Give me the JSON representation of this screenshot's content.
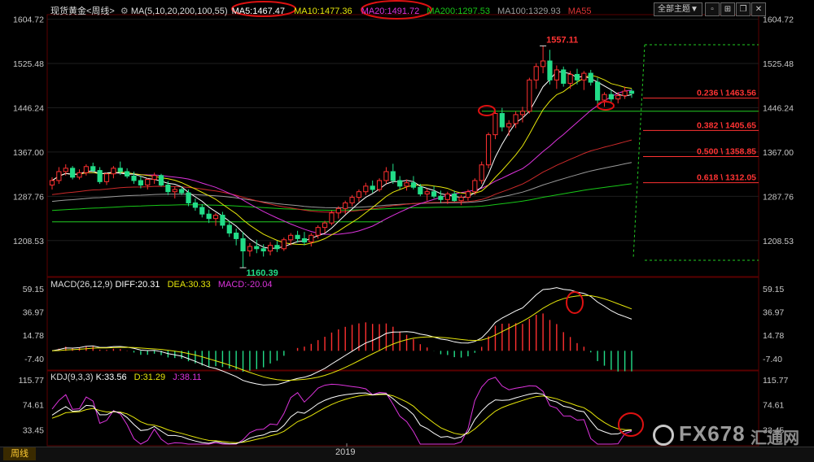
{
  "header": {
    "symbol": "现货黄金",
    "period_label": "<周线>",
    "ma_params": "MA(5,10,20,200,100,55)",
    "ma5": "MA5:1467.47",
    "ma10": "MA10:1477.36",
    "ma20": "MA20:1491.72",
    "ma200": "MA200:1297.53",
    "ma100": "MA100:1329.93",
    "ma55": "MA55",
    "theme_button": "全部主题▼",
    "icons": [
      "box-icon",
      "grid-icon",
      "restore-icon",
      "close-icon"
    ]
  },
  "footer": {
    "period_tab": "周线",
    "year_label": "2019"
  },
  "watermark": {
    "text": "FX678",
    "subtext": "汇通网"
  },
  "colors": {
    "up": "#ff3030",
    "down": "#22dd88",
    "ma5": "#ffffff",
    "ma10": "#e6e60a",
    "ma20": "#dd33dd",
    "ma200": "#18c818",
    "ma100": "#9a9a9a",
    "ma55": "#cc2a2a",
    "fib": "#ff3333",
    "annotation": "#dd1111"
  },
  "chart_data": [
    {
      "type": "candlestick",
      "title": "现货黄金<周线>",
      "y_ticks": [
        "1604.72",
        "1525.48",
        "1446.24",
        "1367.00",
        "1287.76",
        "1208.53"
      ],
      "ylim": [
        1150,
        1610
      ],
      "annotations": {
        "high": "1557.11",
        "low": "1160.39"
      },
      "fibonacci": [
        {
          "label": "0.236 \\ 1463.56",
          "value": 1463.56
        },
        {
          "label": "0.382 \\ 1405.65",
          "value": 1405.65
        },
        {
          "label": "0.500 \\ 1358.85",
          "value": 1358.85
        },
        {
          "label": "0.618 \\ 1312.05",
          "value": 1312.05
        }
      ],
      "support_level": 1440,
      "ohlc": [
        [
          1308,
          1322,
          1300,
          1316
        ],
        [
          1316,
          1340,
          1310,
          1332
        ],
        [
          1332,
          1345,
          1325,
          1338
        ],
        [
          1338,
          1342,
          1318,
          1322
        ],
        [
          1322,
          1336,
          1318,
          1330
        ],
        [
          1330,
          1345,
          1325,
          1341
        ],
        [
          1341,
          1348,
          1330,
          1334
        ],
        [
          1334,
          1340,
          1310,
          1314
        ],
        [
          1314,
          1330,
          1308,
          1328
        ],
        [
          1328,
          1342,
          1320,
          1338
        ],
        [
          1338,
          1350,
          1326,
          1332
        ],
        [
          1332,
          1338,
          1320,
          1324
        ],
        [
          1324,
          1332,
          1310,
          1316
        ],
        [
          1316,
          1324,
          1302,
          1308
        ],
        [
          1308,
          1320,
          1300,
          1318
        ],
        [
          1318,
          1330,
          1310,
          1325
        ],
        [
          1325,
          1328,
          1305,
          1308
        ],
        [
          1308,
          1315,
          1290,
          1296
        ],
        [
          1296,
          1305,
          1284,
          1300
        ],
        [
          1300,
          1306,
          1290,
          1294
        ],
        [
          1294,
          1300,
          1270,
          1276
        ],
        [
          1276,
          1284,
          1262,
          1268
        ],
        [
          1268,
          1274,
          1250,
          1256
        ],
        [
          1256,
          1264,
          1240,
          1248
        ],
        [
          1248,
          1258,
          1235,
          1254
        ],
        [
          1254,
          1260,
          1230,
          1236
        ],
        [
          1236,
          1244,
          1215,
          1222
        ],
        [
          1222,
          1230,
          1200,
          1212
        ],
        [
          1212,
          1224,
          1160,
          1190
        ],
        [
          1190,
          1204,
          1180,
          1198
        ],
        [
          1198,
          1210,
          1186,
          1194
        ],
        [
          1194,
          1202,
          1180,
          1190
        ],
        [
          1190,
          1206,
          1182,
          1200
        ],
        [
          1200,
          1208,
          1188,
          1194
        ],
        [
          1194,
          1214,
          1190,
          1210
        ],
        [
          1210,
          1222,
          1200,
          1218
        ],
        [
          1218,
          1226,
          1205,
          1212
        ],
        [
          1212,
          1224,
          1200,
          1206
        ],
        [
          1206,
          1222,
          1198,
          1218
        ],
        [
          1218,
          1236,
          1212,
          1232
        ],
        [
          1232,
          1244,
          1222,
          1240
        ],
        [
          1240,
          1262,
          1236,
          1258
        ],
        [
          1258,
          1270,
          1248,
          1266
        ],
        [
          1266,
          1280,
          1256,
          1276
        ],
        [
          1276,
          1290,
          1270,
          1286
        ],
        [
          1286,
          1300,
          1278,
          1296
        ],
        [
          1296,
          1312,
          1290,
          1306
        ],
        [
          1306,
          1316,
          1294,
          1300
        ],
        [
          1300,
          1320,
          1296,
          1316
        ],
        [
          1316,
          1340,
          1310,
          1332
        ],
        [
          1332,
          1346,
          1310,
          1316
        ],
        [
          1316,
          1324,
          1300,
          1306
        ],
        [
          1306,
          1318,
          1298,
          1312
        ],
        [
          1312,
          1324,
          1300,
          1304
        ],
        [
          1304,
          1310,
          1288,
          1292
        ],
        [
          1292,
          1302,
          1280,
          1296
        ],
        [
          1296,
          1306,
          1284,
          1288
        ],
        [
          1288,
          1298,
          1276,
          1282
        ],
        [
          1282,
          1296,
          1274,
          1292
        ],
        [
          1292,
          1298,
          1278,
          1280
        ],
        [
          1280,
          1290,
          1272,
          1286
        ],
        [
          1286,
          1300,
          1280,
          1296
        ],
        [
          1296,
          1320,
          1290,
          1316
        ],
        [
          1316,
          1350,
          1310,
          1344
        ],
        [
          1344,
          1402,
          1338,
          1398
        ],
        [
          1398,
          1440,
          1390,
          1436
        ],
        [
          1436,
          1446,
          1404,
          1412
        ],
        [
          1412,
          1424,
          1396,
          1418
        ],
        [
          1418,
          1440,
          1410,
          1434
        ],
        [
          1434,
          1448,
          1420,
          1440
        ],
        [
          1440,
          1500,
          1436,
          1496
        ],
        [
          1496,
          1526,
          1480,
          1520
        ],
        [
          1520,
          1557,
          1508,
          1530
        ],
        [
          1530,
          1550,
          1488,
          1496
        ],
        [
          1496,
          1522,
          1480,
          1514
        ],
        [
          1514,
          1520,
          1484,
          1490
        ],
        [
          1490,
          1512,
          1480,
          1506
        ],
        [
          1506,
          1516,
          1488,
          1496
        ],
        [
          1496,
          1512,
          1478,
          1508
        ],
        [
          1508,
          1514,
          1486,
          1492
        ],
        [
          1492,
          1500,
          1452,
          1460
        ],
        [
          1460,
          1474,
          1448,
          1470
        ],
        [
          1470,
          1478,
          1456,
          1462
        ],
        [
          1462,
          1474,
          1454,
          1468
        ],
        [
          1468,
          1484,
          1462,
          1476
        ],
        [
          1476,
          1480,
          1464,
          1472
        ]
      ]
    },
    {
      "type": "line",
      "title": "MACD(26,12,9)",
      "legend": [
        "DIFF:20.31",
        "DEA:30.33",
        "MACD:-20.04"
      ],
      "y_ticks": [
        "59.15",
        "36.97",
        "14.78",
        "-7.40"
      ],
      "ylim": [
        -16,
        66
      ]
    },
    {
      "type": "line",
      "title": "KDJ(9,3,3)",
      "legend": [
        "K:33.56",
        "D:31.29",
        "J:38.11"
      ],
      "y_ticks": [
        "115.77",
        "74.61",
        "33.45"
      ],
      "ylim": [
        10,
        125
      ]
    }
  ]
}
